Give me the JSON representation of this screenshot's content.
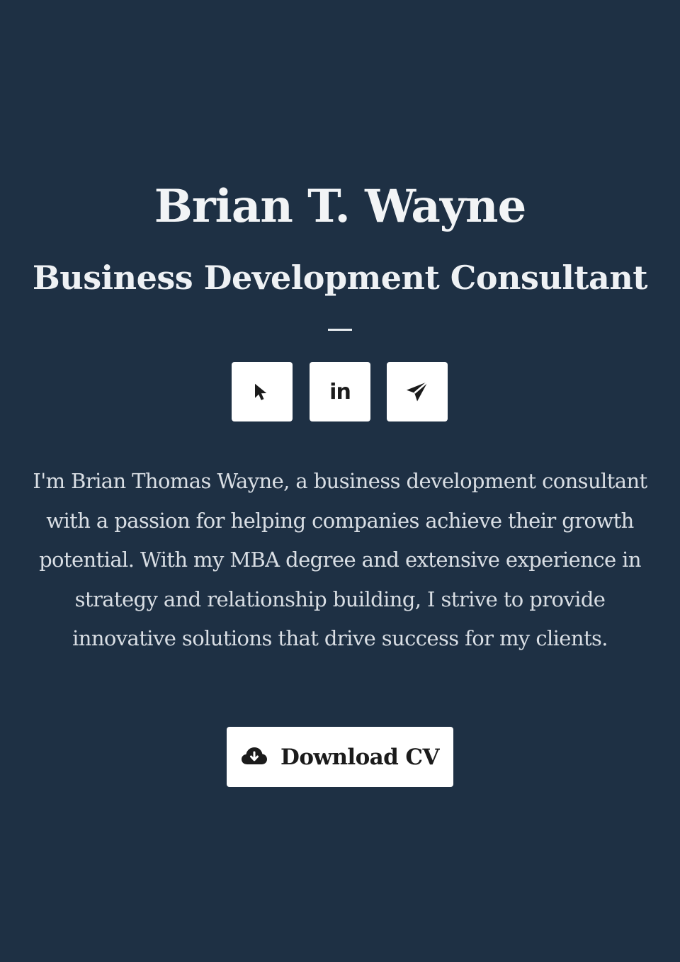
{
  "profile": {
    "name": "Brian T. Wayne",
    "title": "Business Development Consultant",
    "bio": "I'm Brian Thomas Wayne, a business development consultant with a passion for helping companies achieve their growth potential. With my MBA degree and extensive experience in strategy and relationship building, I strive to provide innovative solutions that drive success for my clients."
  },
  "socials": [
    {
      "icon": "cursor-pointer-icon"
    },
    {
      "icon": "linkedin-icon",
      "label": "in"
    },
    {
      "icon": "send-paper-plane-icon"
    }
  ],
  "actions": {
    "download_label": "Download CV",
    "download_icon": "cloud-download-icon"
  },
  "colors": {
    "background": "#1e3044",
    "heading_text": "#f2f4f6",
    "body_text": "#d9dee4",
    "button_bg": "#ffffff",
    "button_text": "#1b1b1b"
  }
}
